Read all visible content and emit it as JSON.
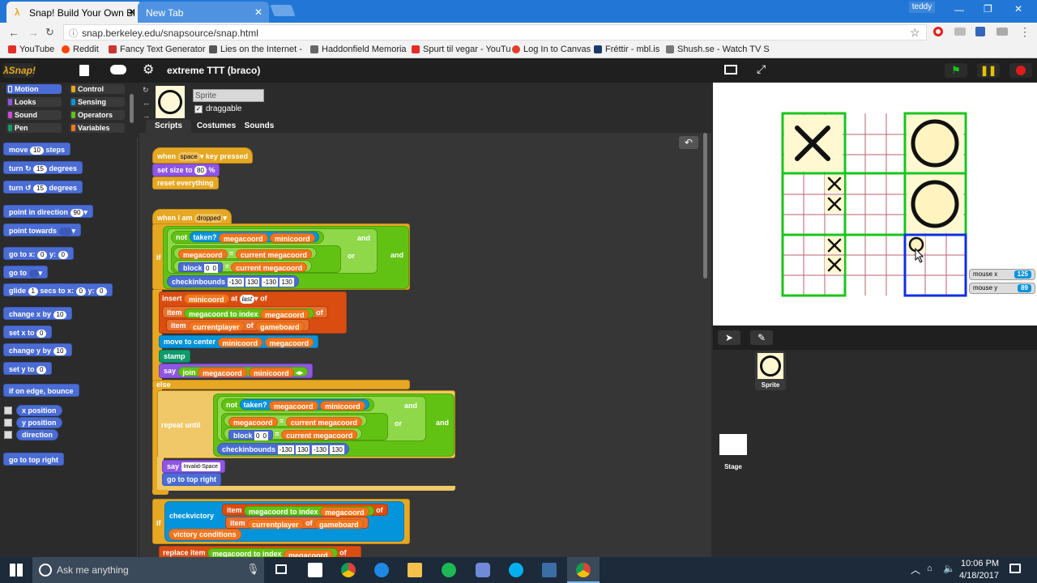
{
  "browser": {
    "user": "teddy",
    "tabs": [
      {
        "title": "Snap! Build Your Own Bl",
        "active": true
      },
      {
        "title": "New Tab",
        "active": false
      }
    ],
    "url": "snap.berkeley.edu/snapsource/snap.html",
    "bookmarks": [
      {
        "label": "YouTube",
        "color": "#e52d27"
      },
      {
        "label": "Reddit",
        "color": "#ff4500"
      },
      {
        "label": "Fancy Text Generator",
        "color": "#cc3333"
      },
      {
        "label": "Lies on the Internet -",
        "color": "#555555"
      },
      {
        "label": "Haddonfield Memoria",
        "color": "#666666"
      },
      {
        "label": "Spurt til vegar - YouTu",
        "color": "#e52d27"
      },
      {
        "label": "Log In to Canvas",
        "color": "#e13f29"
      },
      {
        "label": "Fréttir - mbl.is",
        "color": "#1b3a6b"
      },
      {
        "label": "Shush.se - Watch TV S",
        "color": "#777777"
      }
    ]
  },
  "snap": {
    "project_title": "extreme TTT (braco)",
    "categories": [
      {
        "label": "Motion",
        "color": "#4a6cd4",
        "selected": true
      },
      {
        "label": "Control",
        "color": "#e6a822"
      },
      {
        "label": "Looks",
        "color": "#8f56e3"
      },
      {
        "label": "Sensing",
        "color": "#0494dc"
      },
      {
        "label": "Sound",
        "color": "#cf4ad9"
      },
      {
        "label": "Operators",
        "color": "#62c213"
      },
      {
        "label": "Pen",
        "color": "#0e9a6c"
      },
      {
        "label": "Variables",
        "color": "#f3761d"
      }
    ],
    "palette": {
      "move": "move",
      "move_val": "10",
      "move_unit": "steps",
      "turn_cw": "turn ↻",
      "turn_cw_val": "15",
      "turn_cw_unit": "degrees",
      "turn_ccw": "turn ↺",
      "turn_ccw_val": "15",
      "turn_ccw_unit": "degrees",
      "point_dir": "point in direction",
      "point_dir_val": "90",
      "point_towards": "point towards",
      "goto_xy": "go to x:",
      "goto_x": "0",
      "goto_y_label": "y:",
      "goto_y": "0",
      "goto": "go to",
      "glide": "glide",
      "glide_val": "1",
      "glide_mid": "secs to x:",
      "glide_x": "0",
      "glide_y_label": "y:",
      "glide_y": "0",
      "change_x": "change x by",
      "change_x_val": "10",
      "set_x": "set x to",
      "set_x_val": "0",
      "change_y": "change y by",
      "change_y_val": "10",
      "set_y": "set y to",
      "set_y_val": "0",
      "bounce": "if on edge, bounce",
      "xpos": "x position",
      "ypos": "y position",
      "direction": "direction",
      "custom": "go to top right"
    },
    "sprite": {
      "name": "Sprite",
      "draggable_label": "draggable",
      "tabs": [
        "Scripts",
        "Costumes",
        "Sounds"
      ],
      "active_tab": "Scripts"
    },
    "script1": {
      "hat": "when",
      "key": "space",
      "hat_end": "key pressed",
      "set_size": "set size to",
      "size_val": "80",
      "size_unit": "%",
      "reset": "reset everything"
    },
    "script2": {
      "hat": "when I am",
      "event": "dropped",
      "if": "if",
      "not": "not",
      "taken": "taken?",
      "megacoord": "megacoord",
      "minicoord": "minicoord",
      "and": "and",
      "or": "or",
      "eq": "=",
      "current_megacoord": "current megacoord",
      "block": "block",
      "b1": "0",
      "b2": "0",
      "checkinbounds": "checkinbounds",
      "cb1": "-130",
      "cb2": "130",
      "cb3": "-130",
      "cb4": "130",
      "insert": "insert",
      "at": "at",
      "last": "last",
      "of": "of",
      "item": "item",
      "to_index": "megacoord to index",
      "currentplayer": "currentplayer",
      "gameboard": "gameboard",
      "move_center": "move to center",
      "stamp": "stamp",
      "say": "say",
      "join": "join",
      "else": "else",
      "repeat_until": "repeat until",
      "invalid": "Invalid-Space",
      "goto_top_right": "go to top right",
      "checkvictory": "checkvictory",
      "victory_conditions": "victory conditions",
      "replace": "replace item"
    },
    "stage": {
      "mouse_x_label": "mouse x",
      "mouse_x": "125",
      "mouse_y_label": "mouse y",
      "mouse_y": "89"
    },
    "corral": {
      "sprite_label": "Sprite",
      "stage_label": "Stage"
    }
  },
  "taskbar": {
    "search_placeholder": "Ask me anything",
    "time": "10:06 PM",
    "date": "4/18/2017"
  }
}
